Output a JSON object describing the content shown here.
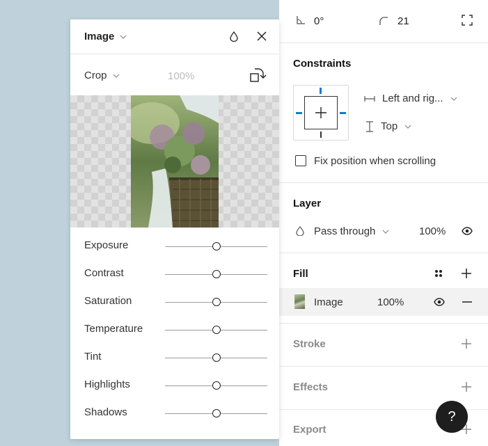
{
  "props": {
    "rotation": "0°",
    "corner_radius": "21",
    "constraints": {
      "title": "Constraints",
      "horizontal": "Left and rig...",
      "vertical": "Top",
      "fix_position_label": "Fix position when scrolling"
    },
    "layer": {
      "title": "Layer",
      "blend_mode": "Pass through",
      "opacity": "100%"
    },
    "fill": {
      "title": "Fill",
      "type": "Image",
      "opacity": "100%"
    },
    "stroke_title": "Stroke",
    "effects_title": "Effects",
    "export_title": "Export",
    "help_label": "?"
  },
  "image_panel": {
    "title": "Image",
    "crop_label": "Crop",
    "zoom": "100%",
    "adjustments": [
      {
        "label": "Exposure",
        "value": 0
      },
      {
        "label": "Contrast",
        "value": 0
      },
      {
        "label": "Saturation",
        "value": 0
      },
      {
        "label": "Temperature",
        "value": 0
      },
      {
        "label": "Tint",
        "value": 0
      },
      {
        "label": "Highlights",
        "value": 0
      },
      {
        "label": "Shadows",
        "value": 0
      }
    ],
    "adjustment_range": [
      -100,
      100
    ]
  },
  "colors": {
    "canvas": "#bfd2db",
    "accent": "#1578d6",
    "help_button": "#1e1e1e"
  }
}
